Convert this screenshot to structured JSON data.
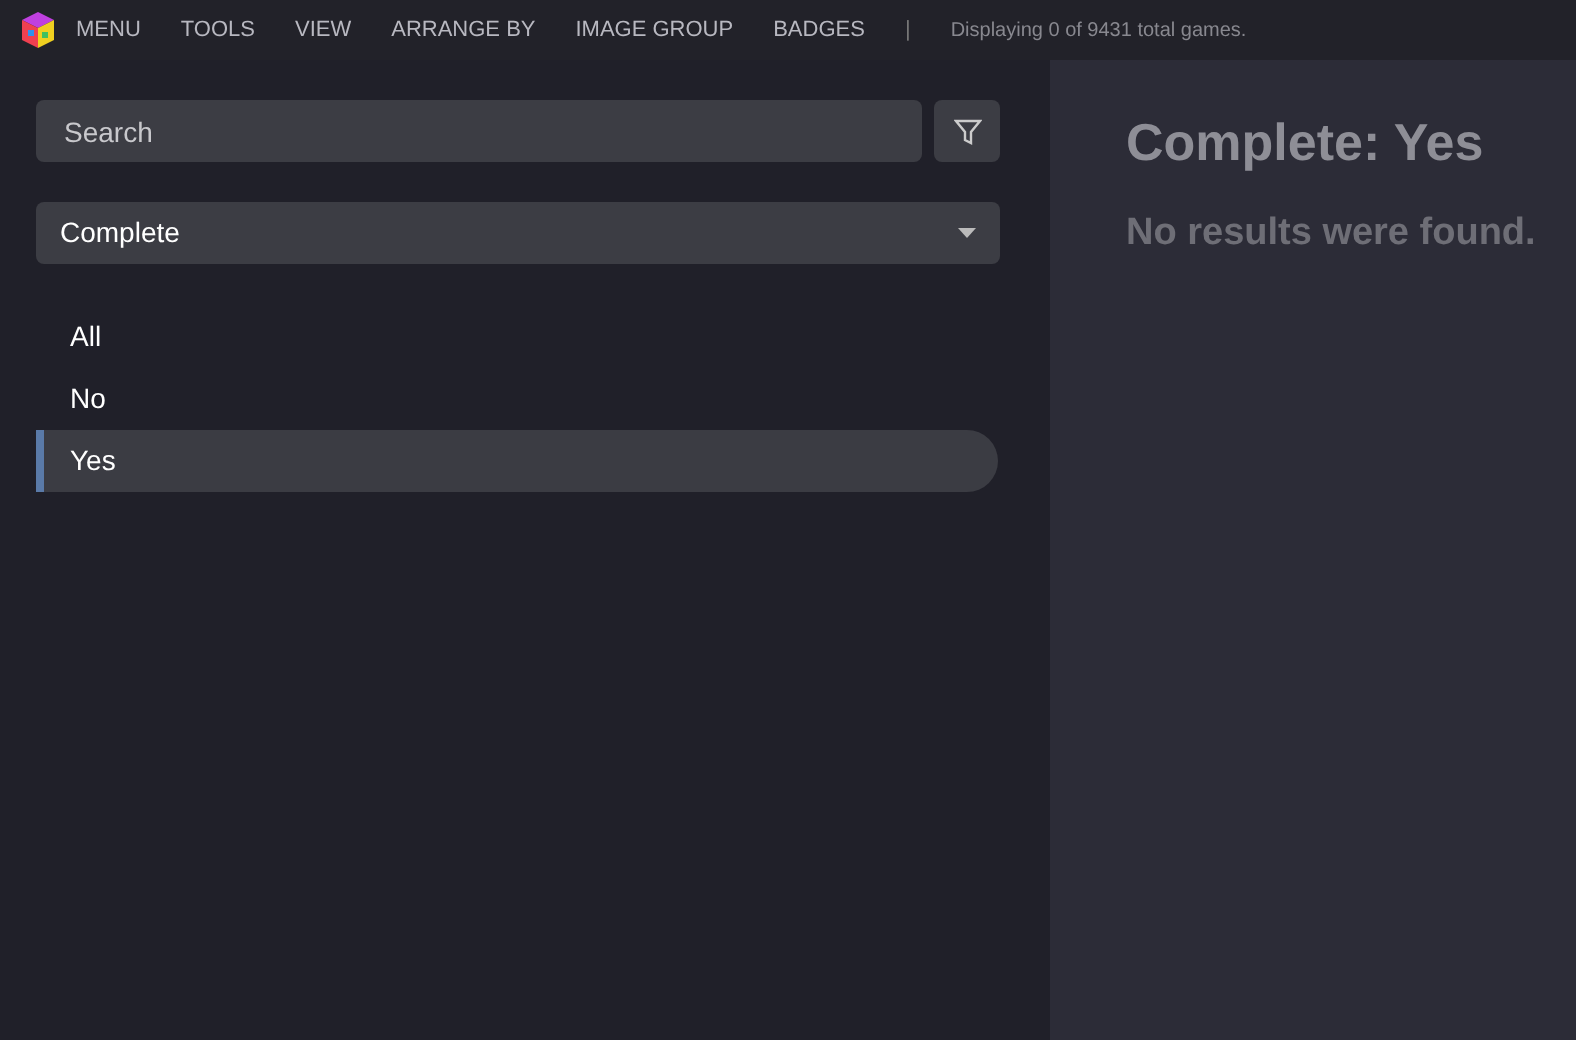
{
  "menu_bar": {
    "items": [
      "MENU",
      "TOOLS",
      "VIEW",
      "ARRANGE BY",
      "IMAGE GROUP",
      "BADGES"
    ],
    "separator": "|",
    "status": "Displaying 0 of 9431 total games."
  },
  "sidebar": {
    "search": {
      "placeholder": "Search"
    },
    "dropdown": {
      "value": "Complete"
    },
    "options": [
      {
        "label": "All",
        "selected": false
      },
      {
        "label": "No",
        "selected": false
      },
      {
        "label": "Yes",
        "selected": true
      }
    ]
  },
  "main": {
    "title": "Complete: Yes",
    "message": "No results were found."
  }
}
